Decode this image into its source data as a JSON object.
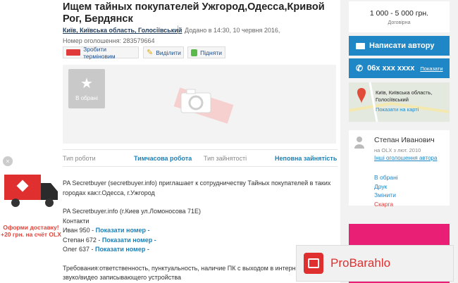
{
  "title": "Ищем тайных покупателей Ужгород,Одесса,Кривой Рог, Бердянск",
  "location": "Київ, Київська область, Голосіївський",
  "added": "Додано в 14:30, 10 червня 2016,",
  "ad_number": "Номер оголошення: 283579664",
  "promo": {
    "urgent": "Зробити терміновим",
    "highlight": "Виділити",
    "raise": "Підняти"
  },
  "favorite_label": "В обрані",
  "params": {
    "job_type_label": "Тип роботи",
    "job_type_value": "Тимчасова робота",
    "employment_label": "Тип зайнятості",
    "employment_value": "Неповна зайнятість"
  },
  "description": {
    "p1": "PA Secretbuyer (secretbuyer.info) приглашает к сотрудничеству Тайных покупателей в таких городах как:г.Одесса, г.Ужгород",
    "p2": "PA Secretbuyer.info (г.Киев ул.Ломоносова 71Е)",
    "contacts": "Контакти",
    "c1_name": "Иван 950 -",
    "c2_name": "Степан 672 -",
    "c3_name": "Олег 637 -",
    "show_number": "Показати номер -",
    "req1": "Требования:ответственность, пунктуальность, наличие ПК с выходом в интернет,",
    "req2": "звуко/видео записывающего устройства"
  },
  "price": {
    "value": "1 000 - 5 000 грн.",
    "note": "Договірна"
  },
  "write_author": "Написати автору",
  "phone": {
    "masked": "06x xxx xxxx",
    "show": "Показати"
  },
  "map": {
    "address": "Київ, Київська область, Голосіївський",
    "show_on_map": "Показати на карті"
  },
  "user": {
    "name": "Степан Иванович",
    "since": "на OLX з лют. 2010",
    "other_ads": "Інші оголошення автора"
  },
  "actions": [
    "В обрані",
    "Друк",
    "Змінити",
    "Скарга"
  ],
  "olx_ad": {
    "line1": "Оформи доставку!",
    "line2": "+20 грн. на счёт OLX"
  },
  "probarahlo": "ProBarahlo"
}
